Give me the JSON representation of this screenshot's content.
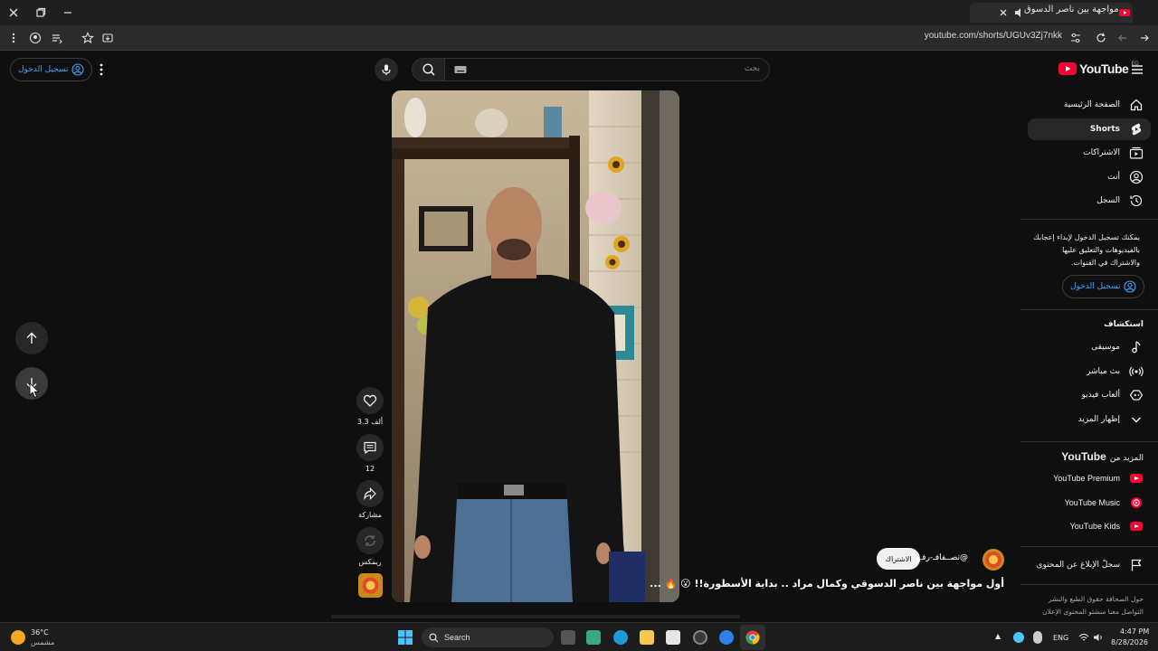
{
  "browser": {
    "tab_title": "أول مواجهة بين ناصر الدسوق",
    "url": "youtube.com/shorts/UGUv3Zj7nkk",
    "new_tab_icon": "plus-icon"
  },
  "header": {
    "logo_text": "YouTube",
    "logo_region": "EG",
    "search_placeholder": "بحث",
    "signin_label": "تسجيل الدخول"
  },
  "sidebar": {
    "items": [
      {
        "label": "الصفحة الرئيسية",
        "icon": "home-icon"
      },
      {
        "label": "Shorts",
        "icon": "shorts-icon"
      },
      {
        "label": "الاشتراكات",
        "icon": "subscriptions-icon"
      },
      {
        "label": "أنت",
        "icon": "you-icon"
      },
      {
        "label": "السجل",
        "icon": "history-icon"
      }
    ],
    "signin_prompt": "يمكنك تسجيل الدخول لإبداء إعجابك بالفيديوهات والتعليق عليها والاشتراك في القنوات.",
    "signin_label": "تسجيل الدخول",
    "explore_title": "استكشاف",
    "explore_items": [
      {
        "label": "موسيقى",
        "icon": "music-icon"
      },
      {
        "label": "بث مباشر",
        "icon": "live-icon"
      },
      {
        "label": "ألعاب فيديو",
        "icon": "gaming-icon"
      },
      {
        "label": "إظهار المزيد",
        "icon": "chevron-down-icon"
      }
    ],
    "more_title_prefix": "المزيد من",
    "more_title_brand": "YouTube",
    "more_items": [
      {
        "label": "YouTube Premium"
      },
      {
        "label": "YouTube Music"
      },
      {
        "label": "YouTube Kids"
      }
    ],
    "report_label": "سجلّ الإبلاغ عن المحتوى",
    "footer_line1": "حول  الصحافة  حقوق الطبع والنشر",
    "footer_line2": "التواصل معنا  منشئو المحتوى  الإعلان"
  },
  "short": {
    "likes": "3.3 ألف",
    "comments": "12",
    "share_label": "مشاركة",
    "remix_label": "ريمكس",
    "channel_handle": "@تصــفافـ-رفـع",
    "subscribe_label": "الاشتراك",
    "title": "أول مواجهة بين ناصر الدسوقي وكمال مراد .. بداية الأسطورة!! 😮 🔥 ..."
  },
  "taskbar": {
    "temp": "36°C",
    "weather": "مشمس",
    "search_label": "Search",
    "lang": "ENG",
    "time": "4:47 PM",
    "date": "8/28/2026"
  }
}
